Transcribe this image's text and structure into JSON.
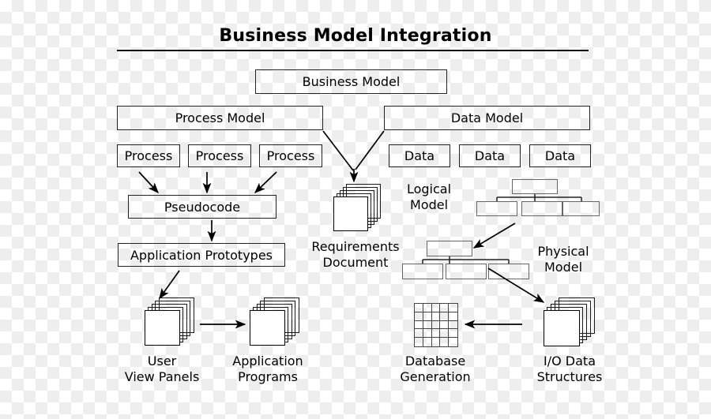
{
  "diagram": {
    "title": "Business Model Integration",
    "type": "flow-diagram"
  },
  "nodes": {
    "business_model": "Business Model",
    "process_model": "Process Model",
    "data_model": "Data Model",
    "process_1": "Process",
    "process_2": "Process",
    "process_3": "Process",
    "data_1": "Data",
    "data_2": "Data",
    "data_3": "Data",
    "pseudocode": "Pseudocode",
    "application_prototypes": "Application Prototypes"
  },
  "labels": {
    "requirements_document": "Requirements\nDocument",
    "logical_model": "Logical\nModel",
    "physical_model": "Physical\nModel",
    "user_view_panels": "User\nView Panels",
    "application_programs": "Application\nPrograms",
    "database_generation": "Database\nGeneration",
    "io_data_structures": "I/O Data\nStructures"
  },
  "colors": {
    "stroke": "#555555",
    "ink": "#000000",
    "background": "#ffffff"
  }
}
